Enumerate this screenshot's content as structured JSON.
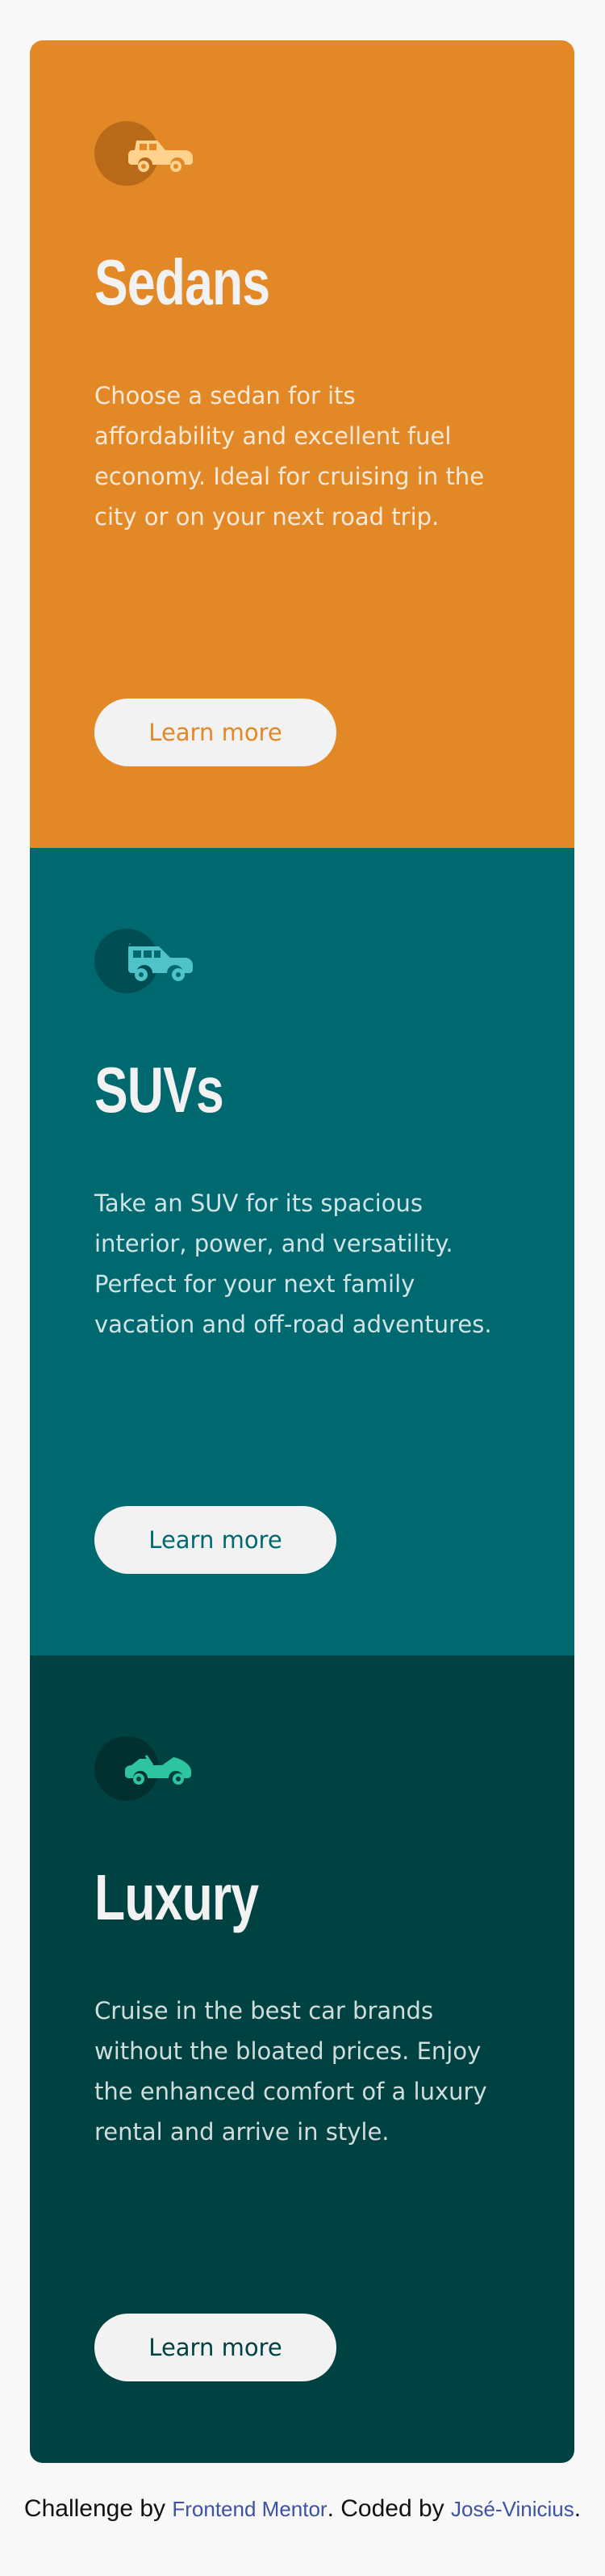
{
  "colors": {
    "sedans_bg": "#e38826",
    "suvs_bg": "#006970",
    "luxury_bg": "#004241",
    "page_bg": "#f8f8f8",
    "button_bg": "#f2f2f2",
    "link": "#3e52a3"
  },
  "cards": [
    {
      "icon": "sedan-car-icon",
      "title": "Sedans",
      "description": "Choose a sedan for its affordability and excellent fuel economy. Ideal for cruising in the city or on your next road trip.",
      "button": "Learn more"
    },
    {
      "icon": "suv-car-icon",
      "title": "SUVs",
      "description": "Take an SUV for its spacious interior, power, and versatility. Perfect for your next family vacation and off-road adventures.",
      "button": "Learn more"
    },
    {
      "icon": "luxury-car-icon",
      "title": "Luxury",
      "description": "Cruise in the best car brands without the bloated prices. Enjoy the enhanced comfort of a luxury rental and arrive in style.",
      "button": "Learn more"
    }
  ],
  "footer": {
    "prefix": "Challenge by ",
    "link1": "Frontend Mentor",
    "middle": ". Coded by ",
    "link2": "José-Vinicius",
    "suffix": "."
  }
}
